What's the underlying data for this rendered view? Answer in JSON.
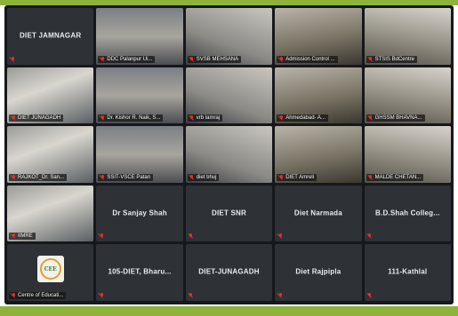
{
  "colors": {
    "frame_accent": "#8db33a",
    "tile_bg": "#2e3136",
    "muted_mic": "#e0312b"
  },
  "tiles": [
    {
      "type": "name",
      "label": "DIET JAMNAGAR"
    },
    {
      "type": "video",
      "label": "DDC Palanpur Ui..."
    },
    {
      "type": "video",
      "label": "SVSB MEHSANA"
    },
    {
      "type": "video",
      "label": "Admission Control ..."
    },
    {
      "type": "video",
      "label": "STSIS BdCentre"
    },
    {
      "type": "video",
      "label": "DIET JUNAGADH"
    },
    {
      "type": "video",
      "label": "Dr. Kishor R. Naik, S..."
    },
    {
      "type": "video",
      "label": "vrb lamraj"
    },
    {
      "type": "video",
      "label": "Ahmedabad- A..."
    },
    {
      "type": "video",
      "label": "GHSSM BHAVNA..."
    },
    {
      "type": "video",
      "label": "RAJKOT_Dr. San..."
    },
    {
      "type": "video",
      "label": "SSIT-VSCE Patan"
    },
    {
      "type": "video",
      "label": "diet bhuj"
    },
    {
      "type": "video",
      "label": "DIET Amreli"
    },
    {
      "type": "video",
      "label": "MALDE CHETAN..."
    },
    {
      "type": "video",
      "label": "IIMRE"
    },
    {
      "type": "name",
      "label": "Dr Sanjay Shah"
    },
    {
      "type": "name",
      "label": "DIET SNR"
    },
    {
      "type": "name",
      "label": "Diet Narmada"
    },
    {
      "type": "name",
      "label": "B.D.Shah Colleg..."
    },
    {
      "type": "logo",
      "label": "Centre of Educati...",
      "logo_text": "CEE"
    },
    {
      "type": "name",
      "label": "105-DIET, Bharu..."
    },
    {
      "type": "name",
      "label": "DIET-JUNAGADH"
    },
    {
      "type": "name",
      "label": "Diet Rajpipla"
    },
    {
      "type": "name",
      "label": "111-Kathlal"
    }
  ]
}
